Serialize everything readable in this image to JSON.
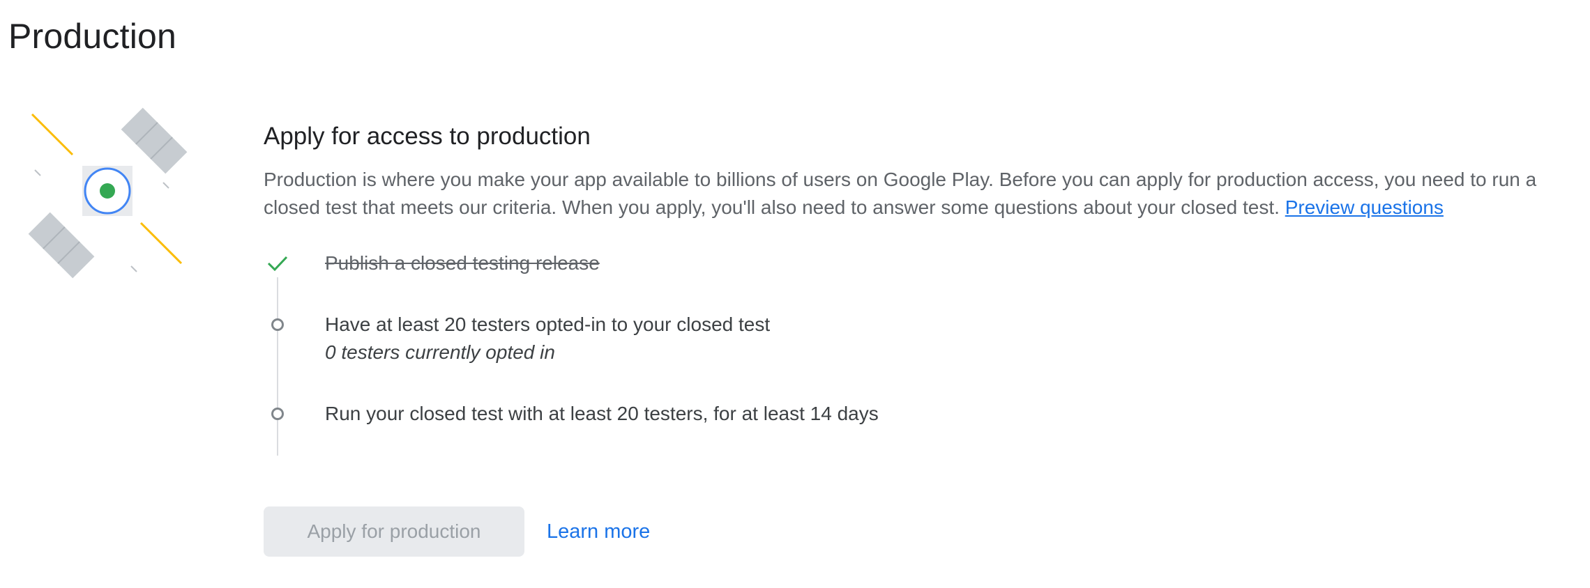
{
  "page": {
    "title": "Production"
  },
  "section": {
    "title": "Apply for access to production",
    "description": "Production is where you make your app available to billions of users on Google Play. Before you can apply for production access, you need to run a closed test that meets our criteria. When you apply, you'll also need to answer some questions about your closed test. ",
    "preview_link": "Preview questions"
  },
  "checklist": [
    {
      "label": "Publish a closed testing release",
      "status": "complete",
      "icon": "check-icon"
    },
    {
      "label": "Have at least 20 testers opted-in to your closed test",
      "sub": "0 testers currently opted in",
      "status": "pending",
      "icon": "circle-icon"
    },
    {
      "label": "Run your closed test with at least 20 testers, for at least 14 days",
      "status": "pending",
      "icon": "circle-icon"
    }
  ],
  "actions": {
    "apply_button": "Apply for production",
    "learn_more": "Learn more"
  },
  "colors": {
    "check": "#34a853",
    "link": "#1a73e8",
    "satellite_accent": "#4285f4",
    "satellite_core": "#34a853",
    "ray": "#fbbc04"
  }
}
